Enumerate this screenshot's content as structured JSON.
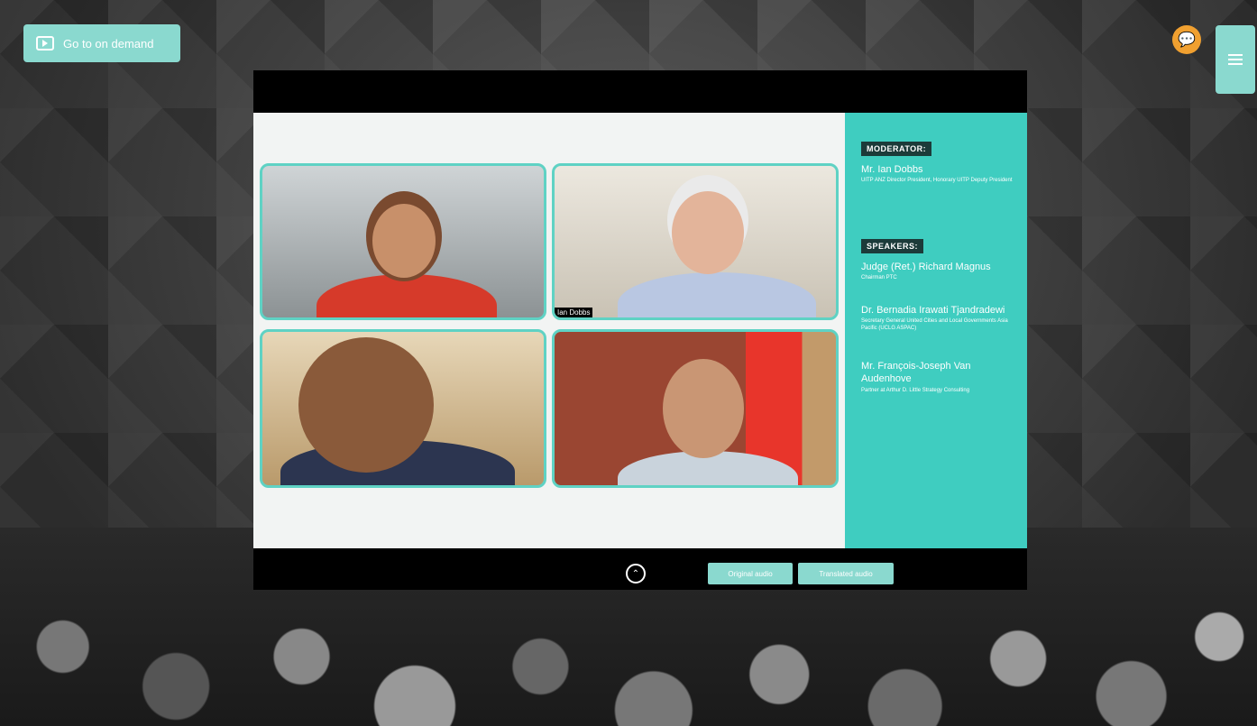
{
  "header": {
    "ondemand_label": "Go to on demand",
    "chat_icon": "chat-bubble-icon",
    "menu_icon": "hamburger-menu-icon"
  },
  "video": {
    "nametag": "Ian Dobbs",
    "sidebar": {
      "moderator_tag": "MODERATOR:",
      "moderator_name": "Mr. Ian Dobbs",
      "moderator_role": "UITP ANZ Director President, Honorary UITP Deputy President",
      "speakers_tag": "SPEAKERS:",
      "speakers": [
        {
          "name": "Judge (Ret.) Richard Magnus",
          "role": "Chairman PTC"
        },
        {
          "name": "Dr. Bernadia Irawati Tjandradewi",
          "role": "Secretary General United Cities and Local Governments Asia Pacific (UCLG ASPAC)"
        },
        {
          "name": "Mr. François-Joseph Van Audenhove",
          "role": "Partner at Arthur D. Little Strategy Consulting"
        }
      ]
    }
  },
  "controls": {
    "original_audio_label": "Original audio",
    "translated_audio_label": "Translated audio"
  },
  "colors": {
    "accent": "#8ad9cf",
    "sidebar": "#3fcdc0",
    "chat": "#f0a030"
  }
}
